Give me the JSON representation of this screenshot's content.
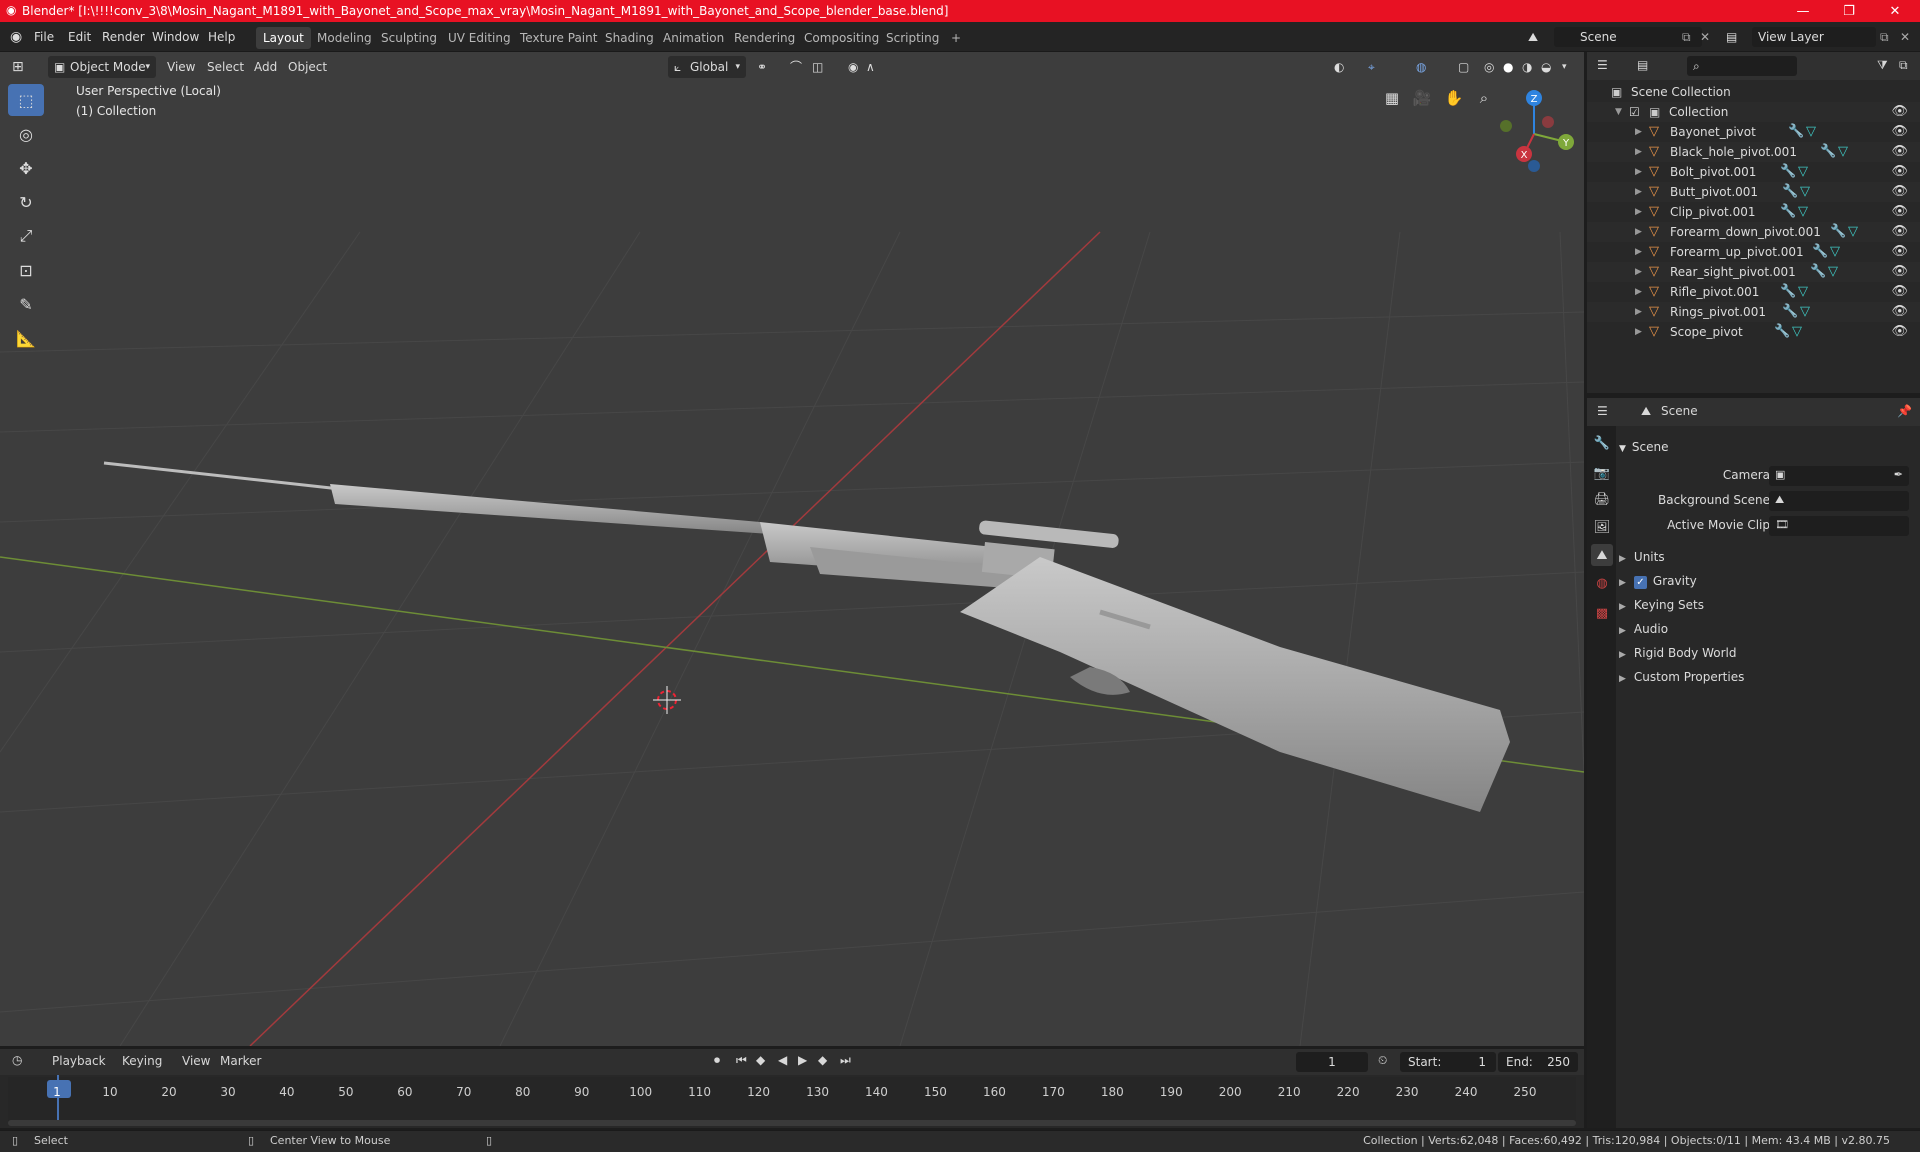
{
  "window": {
    "title": "Blender* [I:\\!!!!conv_3\\8\\Mosin_Nagant_M1891_with_Bayonet_and_Scope_max_vray\\Mosin_Nagant_M1891_with_Bayonet_and_Scope_blender_base.blend]",
    "minimize": "—",
    "maximize": "❐",
    "close": "✕"
  },
  "menu": {
    "items": [
      "File",
      "Edit",
      "Render",
      "Window",
      "Help"
    ],
    "workspaces": [
      "Layout",
      "Modeling",
      "Sculpting",
      "UV Editing",
      "Texture Paint",
      "Shading",
      "Animation",
      "Rendering",
      "Compositing",
      "Scripting"
    ],
    "add_workspace": "+",
    "scene_name": "Scene",
    "view_layer": "View Layer"
  },
  "viewport": {
    "mode": "Object Mode",
    "menus": [
      "View",
      "Select",
      "Add",
      "Object"
    ],
    "transform_orientation": "Global",
    "perspective_label": "User Perspective (Local)",
    "collection_label": "(1) Collection",
    "gizmo": {
      "x": "X",
      "y": "Y",
      "z": "Z"
    }
  },
  "outliner": {
    "root": "Scene Collection",
    "collection": "Collection",
    "objects": [
      "Bayonet_pivot",
      "Black_hole_pivot.001",
      "Bolt_pivot.001",
      "Butt_pivot.001",
      "Clip_pivot.001",
      "Forearm_down_pivot.001",
      "Forearm_up_pivot.001",
      "Rear_sight_pivot.001",
      "Rifle_pivot.001",
      "Rings_pivot.001",
      "Scope_pivot"
    ]
  },
  "properties": {
    "context": "Scene",
    "panel_title": "Scene",
    "fields": [
      {
        "label": "Camera"
      },
      {
        "label": "Background Scene"
      },
      {
        "label": "Active Movie Clip"
      }
    ],
    "subpanels": [
      "Units",
      "Gravity",
      "Keying Sets",
      "Audio",
      "Rigid Body World",
      "Custom Properties"
    ],
    "gravity_checked": true
  },
  "timeline": {
    "menus": [
      "Playback",
      "Keying",
      "View",
      "Marker"
    ],
    "current_frame": "1",
    "start_label": "Start:",
    "start": "1",
    "end_label": "End:",
    "end": "250",
    "ticks": [
      "1",
      "10",
      "20",
      "30",
      "40",
      "50",
      "60",
      "70",
      "80",
      "90",
      "100",
      "110",
      "120",
      "130",
      "140",
      "150",
      "160",
      "170",
      "180",
      "190",
      "200",
      "210",
      "220",
      "230",
      "240",
      "250"
    ]
  },
  "statusbar": {
    "select": "Select",
    "center_view": "Center View to Mouse",
    "info": "Collection | Verts:62,048 | Faces:60,492 | Tris:120,984 | Objects:0/11 | Mem: 43.4 MB | v2.80.75"
  },
  "colors": {
    "accent": "#4772b3",
    "titlebar": "#e81123",
    "x_axis": "#c9343f",
    "y_axis": "#7fa83a",
    "z_axis": "#2f84e0"
  }
}
